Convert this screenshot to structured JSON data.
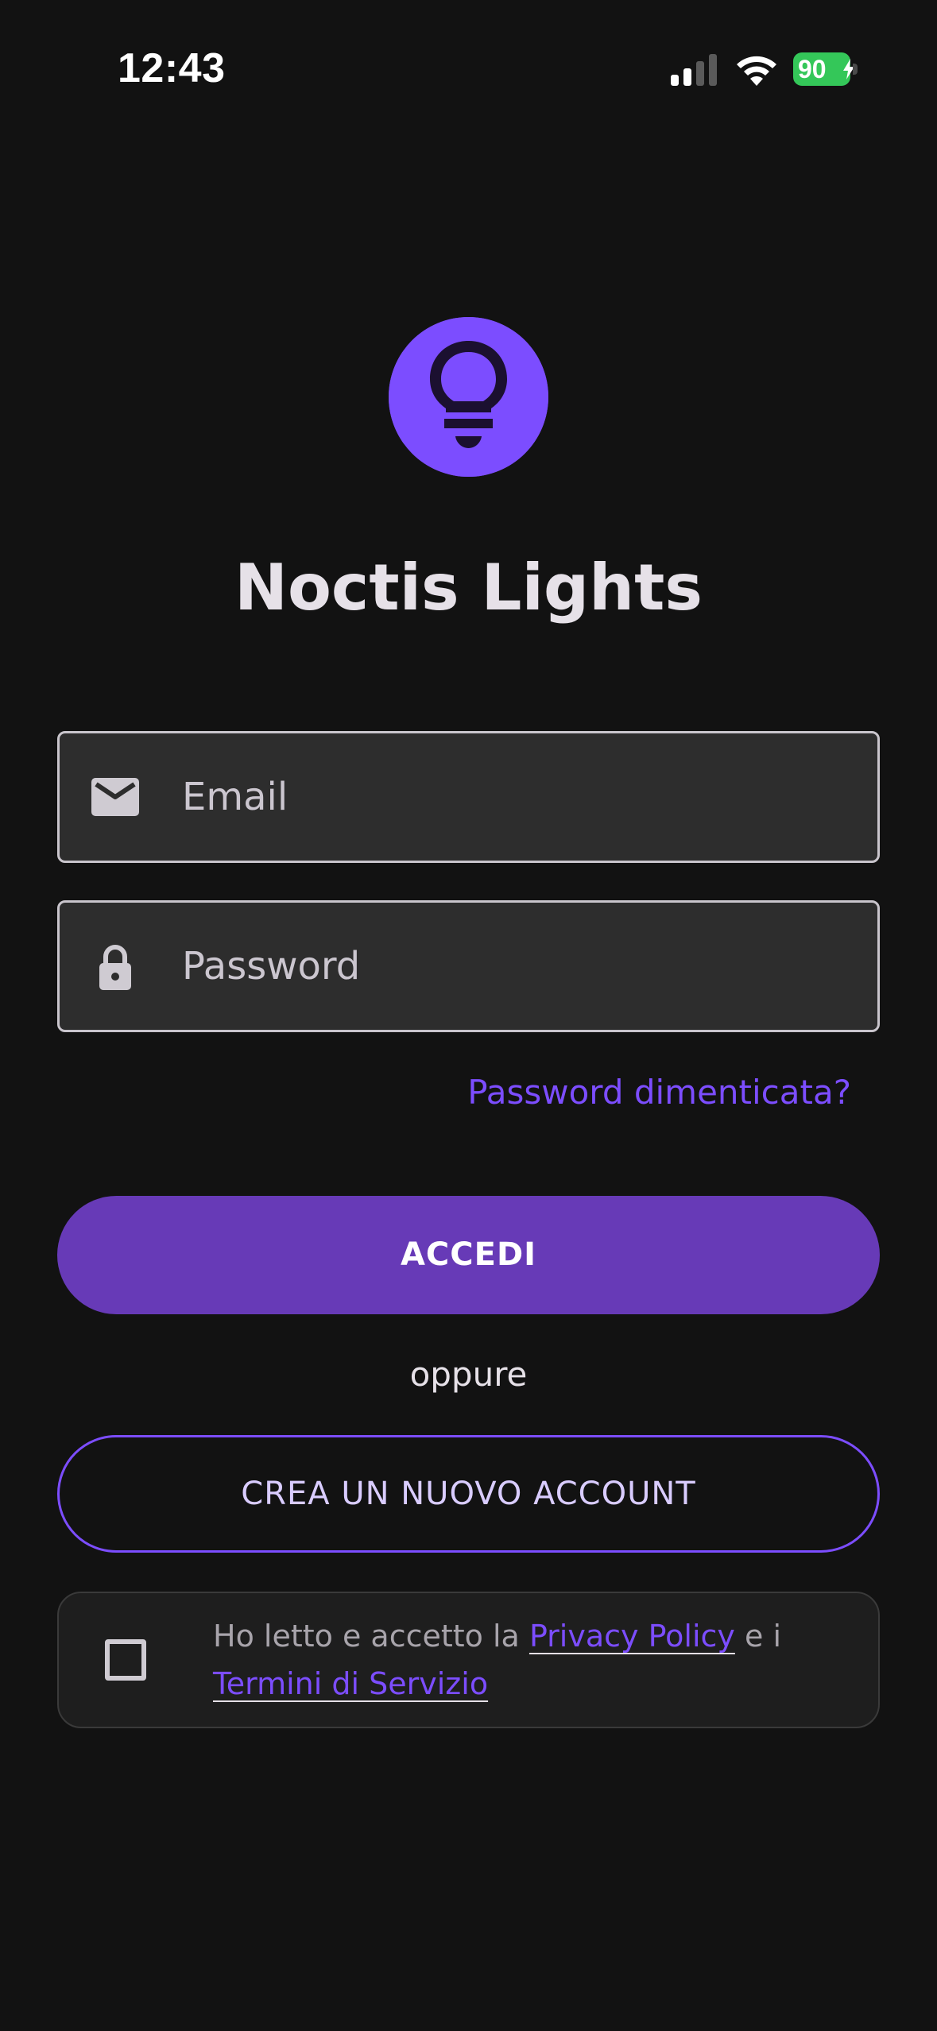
{
  "status_bar": {
    "time": "12:43",
    "battery": "90",
    "icons": [
      "signal-icon",
      "wifi-icon",
      "battery-icon"
    ]
  },
  "app": {
    "logo_icon": "lightbulb-icon",
    "title": "Noctis Lights"
  },
  "form": {
    "email_placeholder": "Email",
    "email_icon": "mail-icon",
    "password_placeholder": "Password",
    "password_icon": "lock-icon",
    "forgot_password": "Password dimenticata?",
    "login_button": "ACCEDI",
    "or": "oppure",
    "create_account_button": "CREA UN NUOVO ACCOUNT"
  },
  "consent": {
    "checked": false,
    "text_before": "Ho letto e accetto la ",
    "privacy_link": "Privacy Policy",
    "text_middle": " e i ",
    "terms_link": "Termini di Servizio"
  },
  "colors": {
    "background": "#121212",
    "accent": "#7c4dff",
    "primary_button": "#673ab7",
    "field_background": "#2d2d2d",
    "battery_green": "#34c759"
  }
}
